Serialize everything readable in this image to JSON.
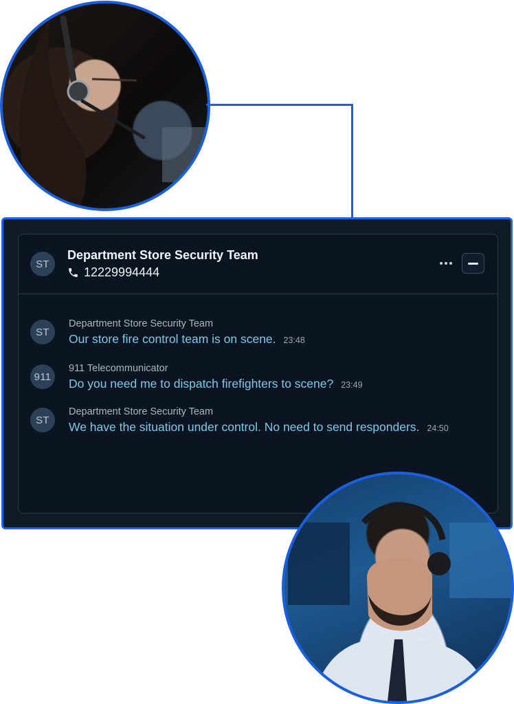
{
  "chat": {
    "contact_initials": "ST",
    "contact_name": "Department Store Security Team",
    "contact_phone": "12229994444",
    "more_icon": "ellipsis-icon",
    "minimize_icon": "minus-icon"
  },
  "messages": [
    {
      "initials": "ST",
      "sender": "Department Store Security Team",
      "text": "Our store fire control team is on scene.",
      "time": "23:48"
    },
    {
      "initials": "911",
      "sender": "911 Telecommunicator",
      "text": "Do you need me to dispatch firefighters to scene?",
      "time": "23:49"
    },
    {
      "initials": "ST",
      "sender": "Department Store Security Team",
      "text": "We have the situation under control. No need to send responders.",
      "time": "24:50"
    }
  ],
  "colors": {
    "accent": "#1b63f0",
    "panel": "#0b1522",
    "message_text": "#7fc9e6"
  }
}
